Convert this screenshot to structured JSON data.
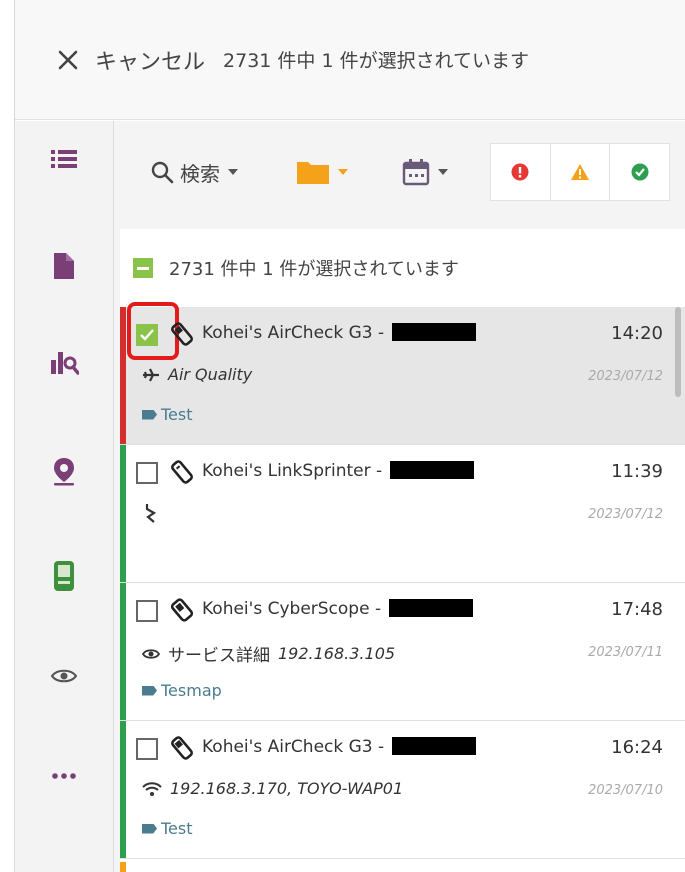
{
  "header": {
    "cancel_label": "キャンセル",
    "selection_count": "2731 件中 1 件が選択されています"
  },
  "sidebar": {
    "items": [
      {
        "icon": "list-icon"
      },
      {
        "icon": "document-icon"
      },
      {
        "icon": "chart-search-icon"
      },
      {
        "icon": "location-pin-icon"
      },
      {
        "icon": "handheld-device-icon"
      },
      {
        "icon": "eye-icon"
      },
      {
        "icon": "more-icon"
      }
    ]
  },
  "toolbar": {
    "search_label": "検索"
  },
  "list": {
    "selection_text": "2731 件中 1 件が選択されています",
    "items": [
      {
        "title": "Kohei's AirCheck G3 -",
        "time": "14:20",
        "subtitle": "Air Quality",
        "date": "2023/07/12",
        "tag": "Test",
        "selected": true
      },
      {
        "title": "Kohei's LinkSprinter -",
        "time": "11:39",
        "subtitle": "",
        "date": "2023/07/12",
        "tag": "",
        "selected": false
      },
      {
        "title": "Kohei's CyberScope -",
        "time": "17:48",
        "subtitle_ja": "サービス詳細",
        "subtitle": "192.168.3.105",
        "date": "2023/07/11",
        "tag": "Tesmap",
        "selected": false
      },
      {
        "title": "Kohei's AirCheck G3 -",
        "time": "16:24",
        "subtitle": "192.168.3.170, TOYO-WAP01",
        "date": "2023/07/10",
        "tag": "Test",
        "selected": false
      }
    ]
  },
  "colors": {
    "accent_green": "#8bc34a",
    "stripe_green": "#2e9e4f",
    "stripe_red": "#d32f2f",
    "warning_orange": "#f5a21a",
    "error_red": "#e53935",
    "nav_purple": "#7b3f78",
    "tag_blue": "#4a7c8f"
  }
}
